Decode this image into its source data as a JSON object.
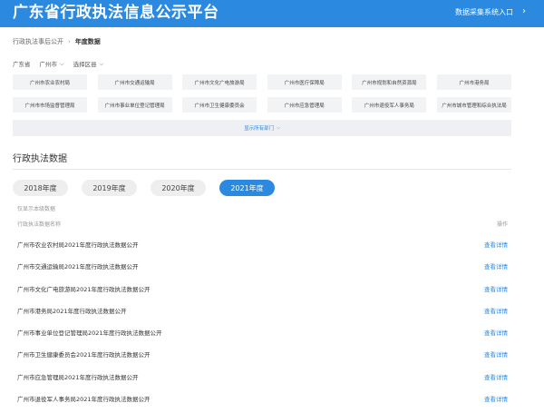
{
  "header": {
    "title": "广东省行政执法信息公示平台",
    "entry_label": "数据采集系统入口",
    "entry_arrow": "›"
  },
  "breadcrumb": {
    "parent": "行政执法事后公开",
    "separator": "›",
    "current": "年度数据"
  },
  "region": {
    "province": "广东省",
    "city": "广州市",
    "district": "选择区县"
  },
  "departments": [
    "广州市农业农村局",
    "广州市交通运输局",
    "广州市文化广电旅游局",
    "广州市医疗保障局",
    "广州市规划和自然资源局",
    "广州市港务局",
    "广州市市场监督管理局",
    "广州市事业单位登记管理局",
    "广州市卫生健康委员会",
    "广州市应急管理局",
    "广州市退役军人事务局",
    "广州市城市管理和综合执法局"
  ],
  "show_all_label": "显示所有部门",
  "section": {
    "title": "行政执法数据"
  },
  "years": [
    {
      "label": "2018年度",
      "active": false
    },
    {
      "label": "2019年度",
      "active": false
    },
    {
      "label": "2020年度",
      "active": false
    },
    {
      "label": "2021年度",
      "active": true
    }
  ],
  "scope_note": "仅显示本级数据",
  "table": {
    "col_name": "行政执法数据名称",
    "col_op": "操作",
    "link_label": "查看详情",
    "rows": [
      "广州市农业农村局2021年度行政执法数据公开",
      "广州市交通运输局2021年度行政执法数据公开",
      "广州市文化广电旅游局2021年度行政执法数据公开",
      "广州市港务局2021年度行政执法数据公开",
      "广州市事业单位登记管理局2021年度行政执法数据公开",
      "广州市卫生健康委员会2021年度行政执法数据公开",
      "广州市应急管理局2021年度行政执法数据公开",
      "广州市退役军人事务局2021年度行政执法数据公开"
    ]
  },
  "colors": {
    "brand": "#2b8ae0",
    "chip_bg": "#f2f3f5",
    "year_bg": "#eeeeee"
  }
}
